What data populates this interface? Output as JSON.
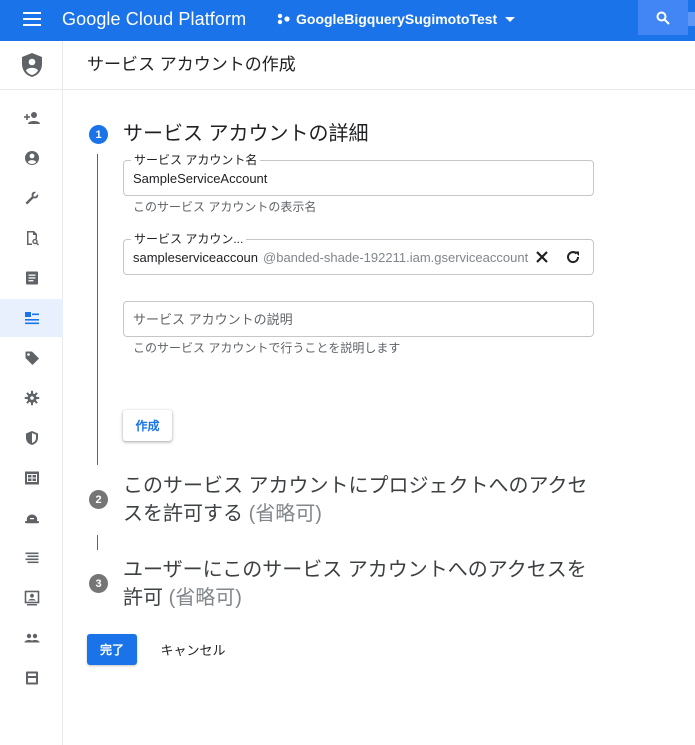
{
  "topbar": {
    "brand": "Google Cloud Platform",
    "project_name": "GoogleBigquerySugimotoTest",
    "icons": [
      "menu-icon",
      "project-dots-icon",
      "dropdown-caret-icon",
      "search-icon"
    ]
  },
  "rail": {
    "header_icon": "shield-account-icon",
    "items": [
      {
        "icon": "person-add-icon"
      },
      {
        "icon": "account-circle-icon"
      },
      {
        "icon": "wrench-icon"
      },
      {
        "icon": "document-search-icon"
      },
      {
        "icon": "list-box-icon"
      },
      {
        "icon": "service-accounts-icon",
        "active": true
      },
      {
        "icon": "tag-icon"
      },
      {
        "icon": "gear-icon"
      },
      {
        "icon": "shield-icon"
      },
      {
        "icon": "grid-box-icon"
      },
      {
        "icon": "cloud-hat-icon"
      },
      {
        "icon": "list-lines-icon"
      },
      {
        "icon": "person-card-icon"
      },
      {
        "icon": "group-icon"
      },
      {
        "icon": "calculator-icon"
      }
    ]
  },
  "page": {
    "title": "サービス アカウントの作成"
  },
  "steps": [
    {
      "number": "1",
      "title": "サービス アカウントの詳細"
    },
    {
      "number": "2",
      "title_line1": "このサービス アカウントにプロジェクトへのアクセ",
      "title_line2": "スを許可する",
      "optional": "(省略可)"
    },
    {
      "number": "3",
      "title_line1": "ユーザーにこのサービス アカウントへのアクセスを",
      "title_line2": "許可",
      "optional": "(省略可)"
    }
  ],
  "form": {
    "name_field": {
      "label": "サービス アカウント名",
      "value": "SampleServiceAccount",
      "hint": "このサービス アカウントの表示名"
    },
    "id_field": {
      "label": "サービス アカウン...",
      "value": "sampleserviceaccoun",
      "suffix": "@banded-shade-192211.iam.gserviceaccount"
    },
    "description_field": {
      "placeholder": "サービス アカウントの説明",
      "hint": "このサービス アカウントで行うことを説明します"
    },
    "create_button": "作成"
  },
  "actions": {
    "done": "完了",
    "cancel": "キャンセル"
  },
  "colors": {
    "brand_blue": "#1a73e8",
    "step_grey": "#757575",
    "active_bg": "#e8f0fe"
  }
}
